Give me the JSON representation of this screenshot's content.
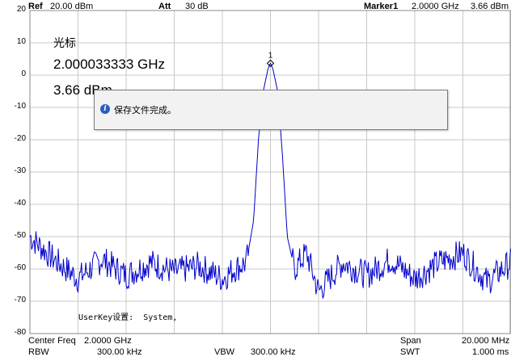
{
  "header": {
    "ref_label": "Ref",
    "ref_value": "20.00 dBm",
    "att_label": "Att",
    "att_value": "30 dB",
    "marker_label": "Marker1",
    "marker_freq": "2.0000 GHz",
    "marker_amp": "3.66 dBm"
  },
  "marker_readout": {
    "title": "光标",
    "freq": "2.000033333 GHz",
    "amp": "3.66 dBm",
    "marker_number": "1"
  },
  "dialog": {
    "message": "保存文件完成。"
  },
  "userkey_text": "UserKey设置:  System,",
  "footer": {
    "center_label": "Center Freq",
    "center_value": "2.0000 GHz",
    "span_label": "Span",
    "span_value": "20.000 MHz",
    "rbw_label": "RBW",
    "rbw_value": "300.00 kHz",
    "vbw_label": "VBW",
    "vbw_value": "300.00 kHz",
    "swt_label": "SWT",
    "swt_value": "1.000 ms"
  },
  "colors": {
    "trace": "#0000cc",
    "grid": "#c8c8c8",
    "dialog_icon": "#2a5cc0"
  },
  "chart_data": {
    "type": "line",
    "title": "",
    "xlabel": "",
    "ylabel": "",
    "ylim": [
      -80,
      20
    ],
    "yticks": [
      "20",
      "10",
      "0",
      "-10",
      "-20",
      "-30",
      "-40",
      "-50",
      "-60",
      "-70",
      "-80"
    ],
    "x_range_ghz": [
      1.99,
      2.01
    ],
    "grid": true,
    "series": [
      {
        "x": [
          1.99,
          1.991,
          1.992,
          1.993,
          1.994,
          1.995,
          1.996,
          1.997,
          1.998,
          1.9985,
          1.999,
          1.9993,
          1.9995,
          1.9997,
          1.9999,
          2.0,
          2.0001,
          2.0003,
          2.0005,
          2.0007,
          2.001,
          2.0015,
          2.002,
          2.003,
          2.004,
          2.005,
          2.006,
          2.007,
          2.008,
          2.009,
          2.01
        ],
        "y": [
          -50,
          -57,
          -63,
          -57,
          -62,
          -58,
          -61,
          -59,
          -63,
          -60,
          -58,
          -45,
          -20,
          -5,
          2,
          3.66,
          2,
          -5,
          -25,
          -50,
          -60,
          -55,
          -67,
          -58,
          -62,
          -57,
          -63,
          -58,
          -55,
          -64,
          -58
        ]
      }
    ]
  }
}
